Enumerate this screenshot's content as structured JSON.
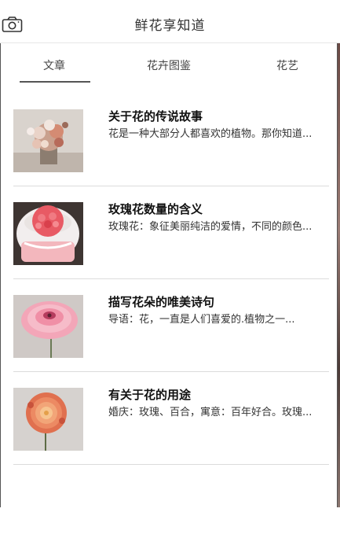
{
  "header": {
    "title": "鲜花享知道",
    "camera_icon": "camera-icon"
  },
  "tabs": [
    {
      "label": "文章",
      "active": true
    },
    {
      "label": "花卉图鉴",
      "active": false
    },
    {
      "label": "花艺",
      "active": false
    }
  ],
  "articles": [
    {
      "title": "关于花的传说故事",
      "summary": "花是一种大部分人都喜欢的植物。那你知道...",
      "thumb": "flower-arrangement-image"
    },
    {
      "title": "玫瑰花数量的含义",
      "summary": "玫瑰花：象征美丽纯洁的爱情，不同的颜色...",
      "thumb": "pink-rose-bouquet-image"
    },
    {
      "title": "描写花朵的唯美诗句",
      "summary": "导语：花，一直是人们喜爱的.植物之一...",
      "thumb": "pink-ranunculus-image"
    },
    {
      "title": "有关于花的用途",
      "summary": "婚庆：玫瑰、百合，寓意：百年好合。玫瑰...",
      "thumb": "orange-dahlia-image"
    }
  ],
  "colors": {
    "accent": "#555555",
    "divider": "#dcdcdc"
  }
}
